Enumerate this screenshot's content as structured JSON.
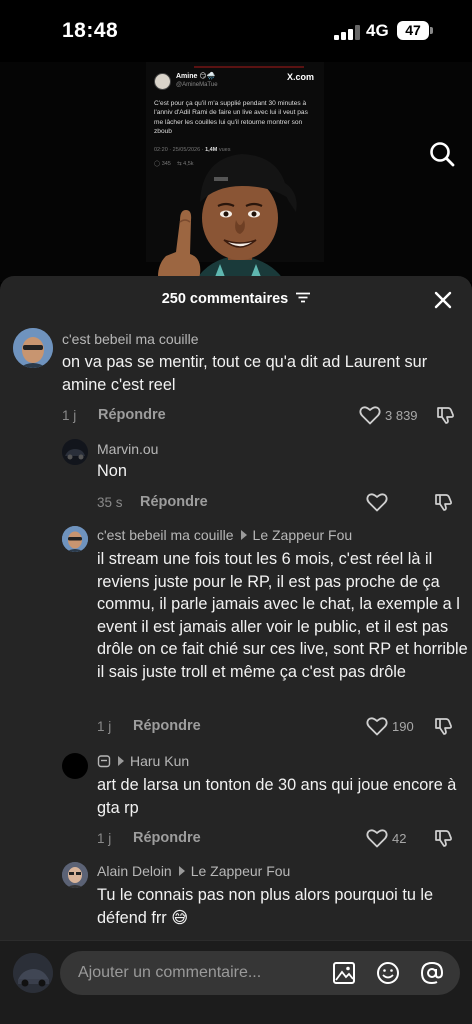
{
  "status_bar": {
    "time": "18:48",
    "network": "4G",
    "battery": "47"
  },
  "video": {
    "tweet": {
      "author": "Amine 😏🌧️",
      "handle": "@AmineMaTue",
      "brand": "X.com",
      "text": "C'est pour ça qu'il m'a supplié pendant 30 minutes à l'anniv d'Adil Rami de faire un live avec lui il veut pas me lâcher les couilles lui qu'il retourne montrer son zboub",
      "meta": "02:20 · 25/05/2026 · ",
      "views": "1,4M",
      "views_label": " vues",
      "stats": [
        "345",
        "4,5k"
      ]
    },
    "search_icon": "search-icon"
  },
  "comments_sheet": {
    "title": "250 commentaires",
    "reply_label": "Répondre",
    "comments": [
      {
        "user": "c'est bebeil ma couille",
        "text": "on va pas se mentir, tout ce qu'a dit ad Laurent sur amine c'est reel",
        "time": "1 j",
        "likes": "3 839"
      },
      {
        "user": "Marvin.ou",
        "text": "Non",
        "time": "35 s",
        "likes": ""
      },
      {
        "user": "c'est bebeil ma couille",
        "reply_to": "Le Zappeur Fou",
        "text": "il stream une fois tout les 6 mois, c'est réel là il reviens juste pour le RP, il est pas proche de ça commu, il parle jamais avec le chat, la exemple a l event il est jamais aller voir le public, et il est pas drôle on ce fait chié sur ces live, sont RP et horrible il sais juste troll et même ça c'est pas drôle",
        "time": "1 j",
        "likes": "190"
      },
      {
        "user": "",
        "reply_to": "Haru Kun",
        "text": "art de larsa un tonton de 30 ans qui joue encore à gta rp",
        "time": "1 j",
        "likes": "42"
      },
      {
        "user": "Alain Deloin",
        "reply_to": "Le Zappeur Fou",
        "text": "Tu le connais pas non plus alors pourquoi tu le défend frr 😅"
      }
    ]
  },
  "input_bar": {
    "placeholder": "Ajouter un commentaire..."
  },
  "colors": {
    "sheet_bg": "#252525",
    "text_primary": "#f2f2f2",
    "text_secondary": "#b7b7b7",
    "input_bg": "#363636"
  }
}
